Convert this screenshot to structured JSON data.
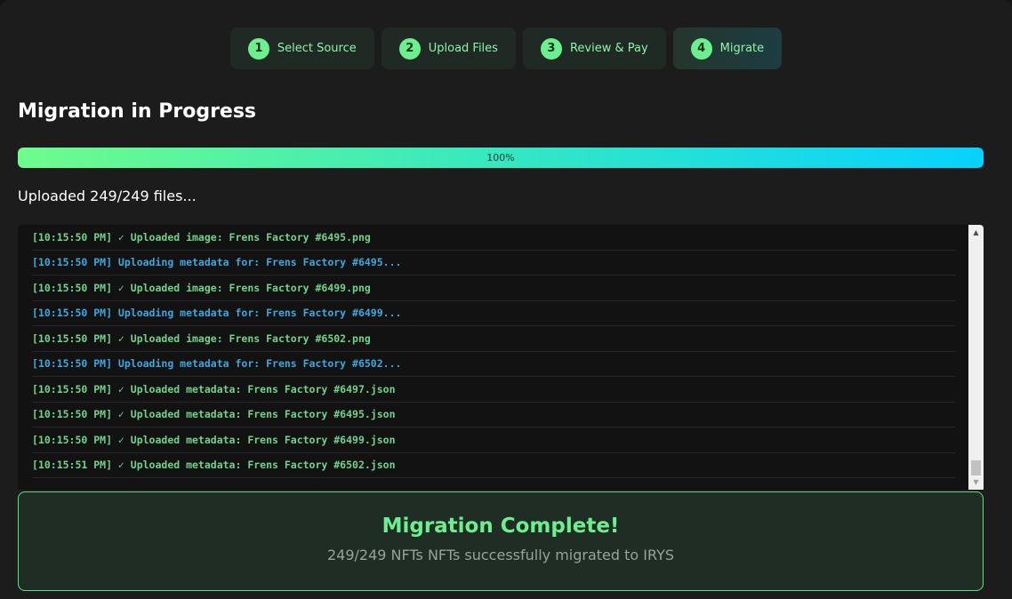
{
  "steps": [
    {
      "number": "1",
      "label": "Select Source"
    },
    {
      "number": "2",
      "label": "Upload Files"
    },
    {
      "number": "3",
      "label": "Review & Pay"
    },
    {
      "number": "4",
      "label": "Migrate"
    }
  ],
  "page": {
    "title": "Migration in Progress",
    "progress_label": "100%",
    "progress_percent": 100,
    "status_text": "Uploaded 249/249 files..."
  },
  "log": [
    {
      "type": "success",
      "text": "[10:15:50 PM] ✓ Uploaded image: Frens Factory #6495.png"
    },
    {
      "type": "info",
      "text": "[10:15:50 PM] Uploading metadata for: Frens Factory #6495..."
    },
    {
      "type": "success",
      "text": "[10:15:50 PM] ✓ Uploaded image: Frens Factory #6499.png"
    },
    {
      "type": "info",
      "text": "[10:15:50 PM] Uploading metadata for: Frens Factory #6499..."
    },
    {
      "type": "success",
      "text": "[10:15:50 PM] ✓ Uploaded image: Frens Factory #6502.png"
    },
    {
      "type": "info",
      "text": "[10:15:50 PM] Uploading metadata for: Frens Factory #6502..."
    },
    {
      "type": "success",
      "text": "[10:15:50 PM] ✓ Uploaded metadata: Frens Factory #6497.json"
    },
    {
      "type": "success",
      "text": "[10:15:50 PM] ✓ Uploaded metadata: Frens Factory #6495.json"
    },
    {
      "type": "success",
      "text": "[10:15:50 PM] ✓ Uploaded metadata: Frens Factory #6499.json"
    },
    {
      "type": "success",
      "text": "[10:15:51 PM] ✓ Uploaded metadata: Frens Factory #6502.json"
    }
  ],
  "complete": {
    "title": "Migration Complete!",
    "subtitle": "249/249 NFTs NFTs successfully migrated to IRYS"
  },
  "colors": {
    "accent_green": "#6cf08f",
    "info_blue": "#3aa9e0",
    "progress_start": "#6efc8c",
    "progress_end": "#06d2ff"
  },
  "icons": {
    "scroll_up": "▲",
    "scroll_down": "▼"
  }
}
